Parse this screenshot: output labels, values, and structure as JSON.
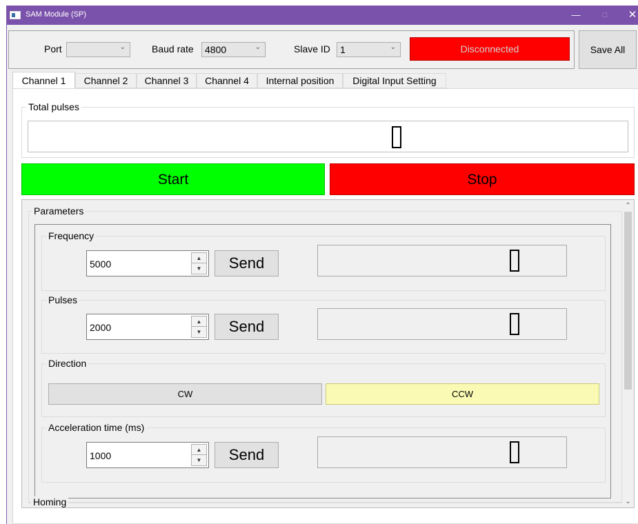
{
  "window": {
    "title": "SAM Module (SP)"
  },
  "connection": {
    "port_label": "Port",
    "port_value": "",
    "baud_label": "Baud rate",
    "baud_value": "4800",
    "slave_label": "Slave ID",
    "slave_value": "1",
    "status": "Disconnected",
    "save_all": "Save All"
  },
  "tabs": [
    {
      "label": "Channel 1",
      "active": true
    },
    {
      "label": "Channel 2"
    },
    {
      "label": "Channel 3"
    },
    {
      "label": "Channel 4"
    },
    {
      "label": "Internal position"
    },
    {
      "label": "Digital Input Setting"
    }
  ],
  "total_pulses": {
    "label": "Total pulses",
    "value": "0"
  },
  "controls": {
    "start": "Start",
    "stop": "Stop"
  },
  "parameters": {
    "title": "Parameters",
    "frequency": {
      "label": "Frequency",
      "value": "5000",
      "send": "Send",
      "display": "0"
    },
    "pulses": {
      "label": "Pulses",
      "value": "2000",
      "send": "Send",
      "display": "0"
    },
    "direction": {
      "label": "Direction",
      "cw": "CW",
      "ccw": "CCW",
      "selected": "CCW"
    },
    "acceleration": {
      "label": "Acceleration time (ms)",
      "value": "1000",
      "send": "Send",
      "display": "0"
    }
  },
  "homing": {
    "title": "Homing"
  },
  "colors": {
    "titlebar": "#7b52ab",
    "disconnected": "#ff0000",
    "start": "#00ff00",
    "stop": "#ff0000",
    "ccw_selected": "#fafab4"
  }
}
